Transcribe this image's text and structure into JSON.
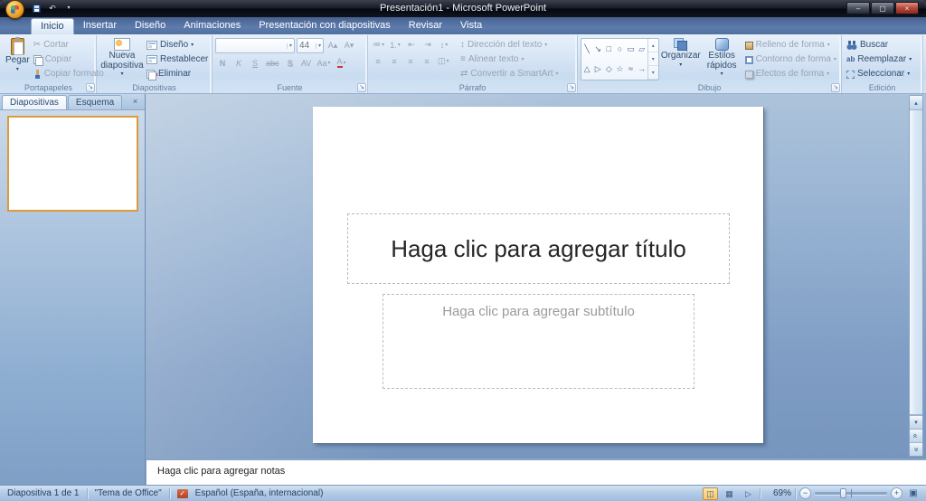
{
  "window": {
    "title": "Presentación1 - Microsoft PowerPoint"
  },
  "tabs": [
    "Inicio",
    "Insertar",
    "Diseño",
    "Animaciones",
    "Presentación con diapositivas",
    "Revisar",
    "Vista"
  ],
  "ribbon": {
    "clipboard": {
      "label": "Portapapeles",
      "paste": "Pegar",
      "cut": "Cortar",
      "copy": "Copiar",
      "format_painter": "Copiar formato"
    },
    "slides": {
      "label": "Diapositivas",
      "new_slide": "Nueva diapositiva",
      "layout": "Diseño",
      "reset": "Restablecer",
      "delete": "Eliminar"
    },
    "font": {
      "label": "Fuente",
      "font_name": "",
      "font_size": "44"
    },
    "paragraph": {
      "label": "Párrafo",
      "text_direction": "Dirección del texto",
      "align_text": "Alinear texto",
      "smartart": "Convertir a SmartArt"
    },
    "drawing": {
      "label": "Dibujo",
      "arrange": "Organizar",
      "quick_styles": "Estilos rápidos",
      "shape_fill": "Relleno de forma",
      "shape_outline": "Contorno de forma",
      "shape_effects": "Efectos de forma",
      "shapes_row1": [
        "╲",
        "↘",
        "□",
        "○",
        "▭",
        "▱"
      ],
      "shapes_row2": [
        "△",
        "▷",
        "◇",
        "☆",
        "≈",
        "→"
      ]
    },
    "editing": {
      "label": "Edición",
      "find": "Buscar",
      "replace": "Reemplazar",
      "select": "Seleccionar"
    }
  },
  "panel": {
    "tab_slides": "Diapositivas",
    "tab_outline": "Esquema"
  },
  "slide": {
    "title_placeholder": "Haga clic para agregar título",
    "subtitle_placeholder": "Haga clic para agregar subtítulo"
  },
  "notes": {
    "placeholder": "Haga clic para agregar notas"
  },
  "status": {
    "slide_info": "Diapositiva 1 de 1",
    "theme": "\"Tema de Office\"",
    "language": "Español (España, internacional)",
    "zoom": "69%"
  },
  "icons": {
    "dropdown": "▾",
    "undo": "↶",
    "minimize": "–",
    "maximize": "▢",
    "close": "×",
    "panel_close": "×",
    "cut": "✂",
    "launcher": "↘",
    "grow_font": "A▴",
    "shrink_font": "A▾",
    "bold": "N",
    "italic": "K",
    "underline": "S",
    "strike": "abc",
    "shadow": "S",
    "spacing": "AV",
    "case": "Aa",
    "color": "A",
    "bullets": "≔",
    "numbering": "1.",
    "indent_dec": "⇤",
    "indent_inc": "⇥",
    "line_spacing": "↕",
    "align_left": "≡",
    "align_center": "≡",
    "align_right": "≡",
    "align_justify": "≡",
    "columns": "◫",
    "text_direction": "↕",
    "align_text": "≡",
    "smartart": "⇄",
    "replace": "ab",
    "scroll_up": "▴",
    "scroll_down": "▾",
    "chevron_double": "«",
    "view_normal": "◫",
    "view_sorter": "▦",
    "view_show": "▷",
    "fit": "▣",
    "zoom_out": "−",
    "zoom_in": "+",
    "check": "✓"
  },
  "colors": {
    "selection_border": "#dc9a3c",
    "accent_orange": "#f5a623",
    "ribbon_bg": "#d7e5f5",
    "desktop_blue": "#7e9dc4",
    "titlebar": "#11141d"
  }
}
